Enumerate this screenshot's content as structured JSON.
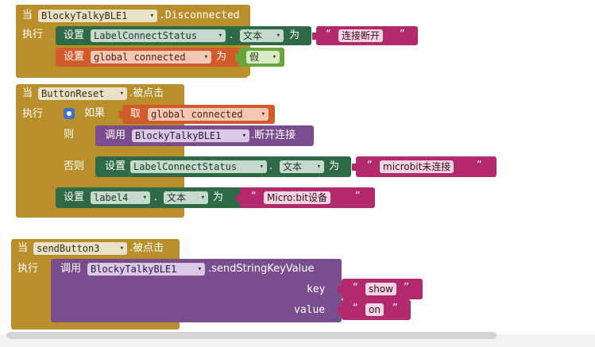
{
  "events": [
    {
      "kw_when": "当",
      "component": "BlockyTalkyBLE1",
      "event_name": ".Disconnected",
      "kw_do": "执行",
      "statements": [
        {
          "kw": "设置",
          "target": "LabelConnectStatus",
          "dot": ".",
          "prop": "文本",
          "kw_to": "为",
          "quote_open": "“",
          "value": "连接断开",
          "quote_close": "”"
        },
        {
          "kw": "设置",
          "target": "global connected",
          "kw_to": "为",
          "value": "假"
        }
      ]
    },
    {
      "kw_when": "当",
      "component": "ButtonReset",
      "event_name": ".被点击",
      "kw_do": "执行",
      "if_block": {
        "kw_if": "如果",
        "kw_get": "取",
        "condition": "global connected",
        "kw_then": "则",
        "then_call": {
          "kw": "调用",
          "component": "BlockyTalkyBLE1",
          "method": ".断开连接"
        },
        "kw_else": "否则",
        "else_set": {
          "kw": "设置",
          "target": "LabelConnectStatus",
          "dot": ".",
          "prop": "文本",
          "kw_to": "为",
          "quote_open": "“",
          "value": "microbit未连接",
          "quote_close": "”"
        }
      },
      "after_set": {
        "kw": "设置",
        "target": "label4",
        "dot": ".",
        "prop": "文本",
        "kw_to": "为",
        "quote_open": "“",
        "value": "Micro:bit设备",
        "quote_close": "”"
      }
    },
    {
      "kw_when": "当",
      "component": "sendButton3",
      "event_name": ".被点击",
      "kw_do": "执行",
      "call": {
        "kw": "调用",
        "component": "BlockyTalkyBLE1",
        "method": ".sendStringKeyValue",
        "args": [
          {
            "label": "key",
            "quote_open": "“",
            "value": "show",
            "quote_close": "”"
          },
          {
            "label": "value",
            "quote_open": "“",
            "value": "on",
            "quote_close": "”"
          }
        ]
      }
    }
  ],
  "dropdown_arrow": "▾",
  "colors": {
    "event": "#b98f2c",
    "setter": "#2f6a47",
    "global": "#d25b2c",
    "call": "#7a4e8e",
    "text": "#b22a6b",
    "logic": "#6ba53a",
    "control": "#5b67a5"
  }
}
